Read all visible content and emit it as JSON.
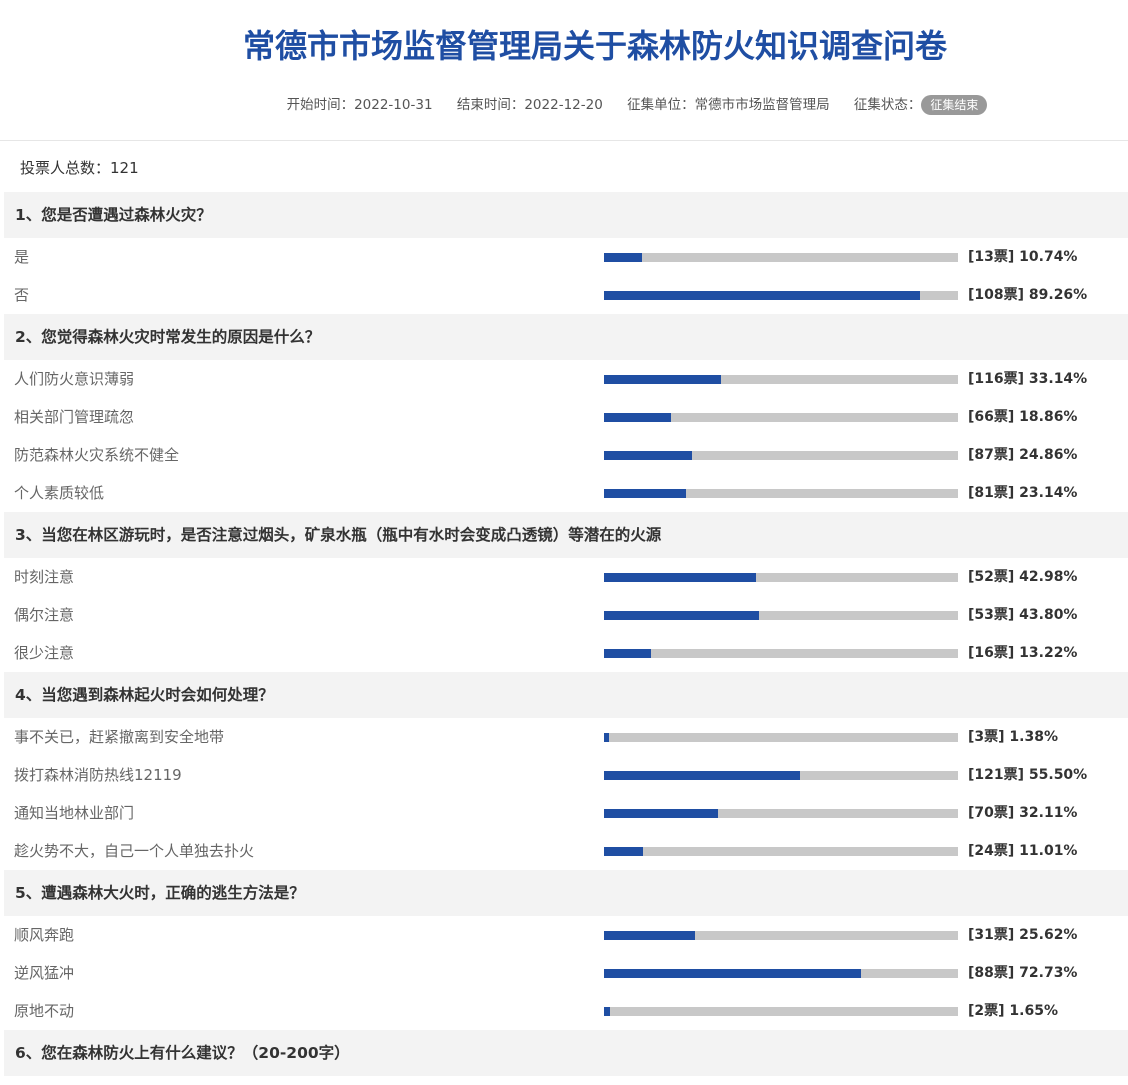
{
  "survey": {
    "title": "常德市市场监督管理局关于森林防火知识调查问卷",
    "meta": {
      "start": "开始时间：2022-10-31",
      "end": "结束时间：2022-12-20",
      "unit": "征集单位：常德市市场监督管理局",
      "status_label": "征集状态：",
      "status_badge": "征集结束"
    },
    "voters": "投票人总数：121",
    "questions": [
      {
        "title": "1、您是否遭遇过森林火灾？",
        "options": [
          {
            "label": "是",
            "stat": "[13票] 10.74%",
            "percent": 10.74
          },
          {
            "label": "否",
            "stat": "[108票] 89.26%",
            "percent": 89.26
          }
        ]
      },
      {
        "title": "2、您觉得森林火灾时常发生的原因是什么？",
        "options": [
          {
            "label": "人们防火意识薄弱",
            "stat": "[116票] 33.14%",
            "percent": 33.14
          },
          {
            "label": "相关部门管理疏忽",
            "stat": "[66票] 18.86%",
            "percent": 18.86
          },
          {
            "label": "防范森林火灾系统不健全",
            "stat": "[87票] 24.86%",
            "percent": 24.86
          },
          {
            "label": "个人素质较低",
            "stat": "[81票] 23.14%",
            "percent": 23.14
          }
        ]
      },
      {
        "title": "3、当您在林区游玩时，是否注意过烟头，矿泉水瓶（瓶中有水时会变成凸透镜）等潜在的火源",
        "options": [
          {
            "label": "时刻注意",
            "stat": "[52票] 42.98%",
            "percent": 42.98
          },
          {
            "label": "偶尔注意",
            "stat": "[53票] 43.80%",
            "percent": 43.8
          },
          {
            "label": "很少注意",
            "stat": "[16票] 13.22%",
            "percent": 13.22
          }
        ]
      },
      {
        "title": "4、当您遇到森林起火时会如何处理？",
        "options": [
          {
            "label": "事不关已，赶紧撤离到安全地带",
            "stat": "[3票] 1.38%",
            "percent": 1.38
          },
          {
            "label": "拨打森林消防热线12119",
            "stat": "[121票] 55.50%",
            "percent": 55.5
          },
          {
            "label": "通知当地林业部门",
            "stat": "[70票] 32.11%",
            "percent": 32.11
          },
          {
            "label": "趁火势不大，自己一个人单独去扑火",
            "stat": "[24票] 11.01%",
            "percent": 11.01
          }
        ]
      },
      {
        "title": "5、遭遇森林大火时，正确的逃生方法是？",
        "options": [
          {
            "label": "顺风奔跑",
            "stat": "[31票] 25.62%",
            "percent": 25.62
          },
          {
            "label": "逆风猛冲",
            "stat": "[88票] 72.73%",
            "percent": 72.73
          },
          {
            "label": "原地不动",
            "stat": "[2票] 1.65%",
            "percent": 1.65
          }
        ]
      },
      {
        "title": "6、您在森林防火上有什么建议？（20-200字）",
        "options": []
      }
    ],
    "colors": {
      "accent": "#1f4ea3",
      "track": "#c8c8c8",
      "badge": "#999999"
    }
  }
}
